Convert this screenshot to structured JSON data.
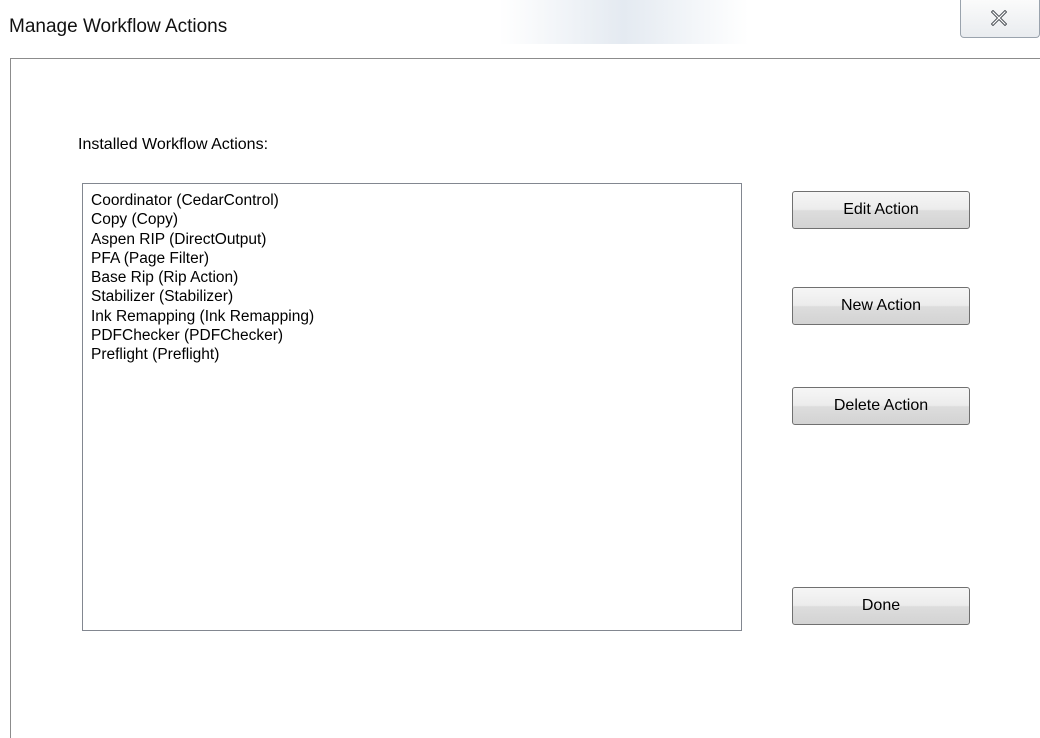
{
  "window": {
    "title": "Manage Workflow Actions",
    "close_icon": "close-icon"
  },
  "dialog": {
    "list_label": "Installed Workflow Actions:",
    "actions": [
      "Coordinator (CedarControl)",
      "Copy (Copy)",
      "Aspen RIP (DirectOutput)",
      "PFA (Page Filter)",
      "Base Rip (Rip Action)",
      "Stabilizer (Stabilizer)",
      "Ink Remapping (Ink Remapping)",
      "PDFChecker (PDFChecker)",
      "Preflight (Preflight)"
    ],
    "buttons": {
      "edit": "Edit Action",
      "new": "New Action",
      "delete": "Delete Action",
      "done": "Done"
    }
  }
}
